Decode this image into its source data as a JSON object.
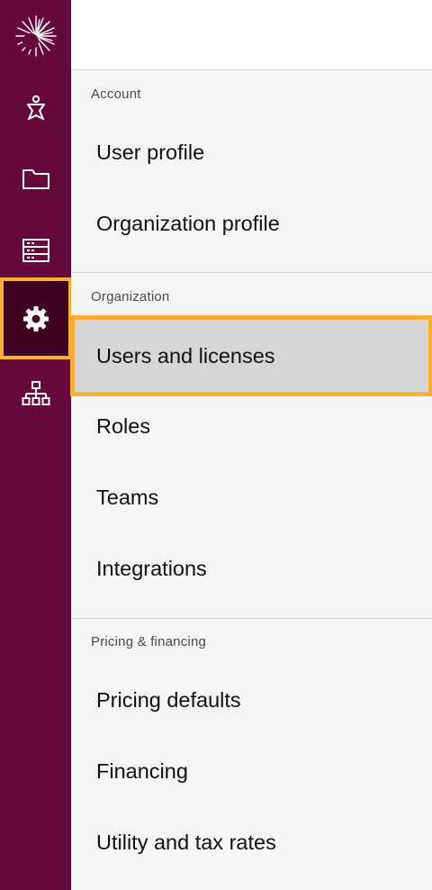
{
  "sidebar": {
    "icons": [
      {
        "name": "logo-icon"
      },
      {
        "name": "person-icon"
      },
      {
        "name": "folder-icon"
      },
      {
        "name": "database-icon"
      },
      {
        "name": "gear-icon",
        "active": true
      },
      {
        "name": "org-chart-icon"
      }
    ]
  },
  "colors": {
    "rail": "#650a3a",
    "rail_active": "#3e0420",
    "highlight": "#fbb033",
    "selected_bg": "#d6d6d6",
    "menu_bg": "#f5f5f5"
  },
  "menu": {
    "account": {
      "heading": "Account",
      "items": [
        "User profile",
        "Organization profile"
      ]
    },
    "organization": {
      "heading": "Organization",
      "items": [
        "Users and licenses",
        "Roles",
        "Teams",
        "Integrations"
      ],
      "selected": "Users and licenses"
    },
    "pricing": {
      "heading": "Pricing & financing",
      "items": [
        "Pricing defaults",
        "Financing",
        "Utility and tax rates"
      ]
    }
  }
}
